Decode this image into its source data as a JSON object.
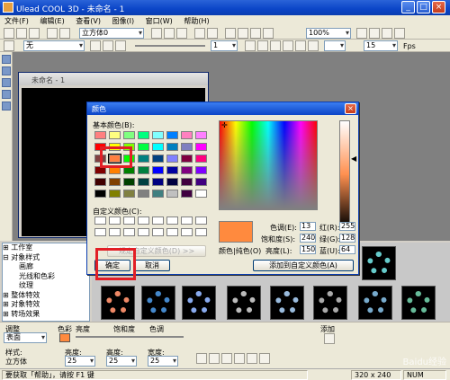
{
  "app": {
    "title": "Ulead COOL 3D - 未命名 - 1"
  },
  "menu": [
    "文件(F)",
    "编辑(E)",
    "查看(V)",
    "图像(I)",
    "窗口(W)",
    "帮助(H)"
  ],
  "toolbar": {
    "object_combo": "立方体0",
    "zoom_combo": "100%",
    "style_combo": "无",
    "frame_value": "1",
    "fps_value": "15",
    "fps_label": "Fps"
  },
  "document": {
    "title": "未命名 - 1"
  },
  "tree": {
    "items": [
      "工作室",
      "对象样式",
      "画廊",
      "光线和色彩",
      "纹理",
      "整体特效",
      "对象特效",
      "转场效果"
    ]
  },
  "properties": {
    "adjust_label": "调整",
    "adjust_value": "表面",
    "color_label": "色彩",
    "brightness_top_label": "亮度",
    "saturation_label": "饱和度",
    "hue_label": "色调",
    "add_label": "添加",
    "style_label": "样式:",
    "style_value": "立方体",
    "brightness_label": "亮度:",
    "brightness_value": "25",
    "height_label": "高度:",
    "height_value": "25",
    "width_label": "宽度:",
    "width_value": "25"
  },
  "status": {
    "help_text": "要获取「帮助」，请按 F1 键",
    "size": "320 x 240",
    "num": "NUM"
  },
  "color_dialog": {
    "title": "颜色",
    "close_glyph": "×",
    "basic_colors_label": "基本颜色(B):",
    "custom_colors_label": "自定义颜色(C):",
    "define_custom_button": "规定自定义颜色(D) >>",
    "ok_button": "确定",
    "cancel_button": "取消",
    "solid_label": "颜色|纯色(O)",
    "add_custom_button": "添加到自定义颜色(A)",
    "hue_label": "色调(E):",
    "hue_value": "13",
    "sat_label": "饱和度(S):",
    "sat_value": "240",
    "lum_label": "亮度(L):",
    "lum_value": "150",
    "red_label": "红(R):",
    "red_value": "255",
    "green_label": "绿(G):",
    "green_value": "128",
    "blue_label": "蓝(U):",
    "blue_value": "64",
    "basic_colors": [
      "#ff8080",
      "#ffff80",
      "#80ff80",
      "#00ff80",
      "#80ffff",
      "#0080ff",
      "#ff80c0",
      "#ff80ff",
      "#ff0000",
      "#ffff00",
      "#80ff00",
      "#00ff40",
      "#00ffff",
      "#0080c0",
      "#8080c0",
      "#ff00ff",
      "#804040",
      "#ff8040",
      "#00ff00",
      "#008080",
      "#004080",
      "#8080ff",
      "#800040",
      "#ff0080",
      "#800000",
      "#ff8000",
      "#008000",
      "#008040",
      "#0000ff",
      "#0000a0",
      "#800080",
      "#8000ff",
      "#400000",
      "#804000",
      "#004000",
      "#004040",
      "#000080",
      "#000040",
      "#400040",
      "#400080",
      "#000000",
      "#808000",
      "#808040",
      "#808080",
      "#408080",
      "#c0c0c0",
      "#400040",
      "#ffffff"
    ]
  },
  "watermark": "Baidu经验"
}
